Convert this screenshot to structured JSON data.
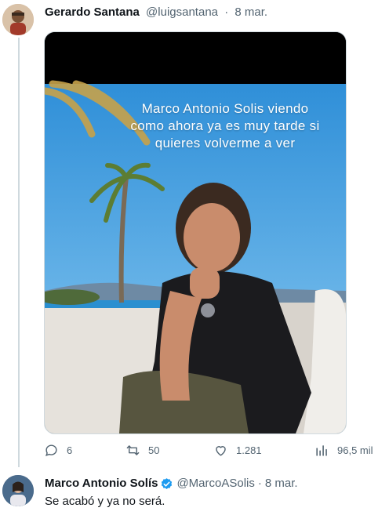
{
  "tweet": {
    "author_name": "Gerardo Santana",
    "handle": "@luigsantana",
    "separator": "·",
    "date": "8 mar.",
    "image_text": "Marco Antonio Solis viendo como ahora ya es muy tarde si quieres volverme a ver",
    "actions": {
      "replies": "6",
      "retweets": "50",
      "likes": "1.281",
      "views": "96,5 mil"
    }
  },
  "reply": {
    "author_name": "Marco Antonio Solís",
    "handle": "@MarcoASolis",
    "separator": "·",
    "date": "8 mar.",
    "text": "Se acabó y ya no será.",
    "verified": true
  },
  "colors": {
    "secondary_text": "#536471",
    "verified_blue": "#1d9bf0",
    "thread_line": "#cfd9de"
  }
}
